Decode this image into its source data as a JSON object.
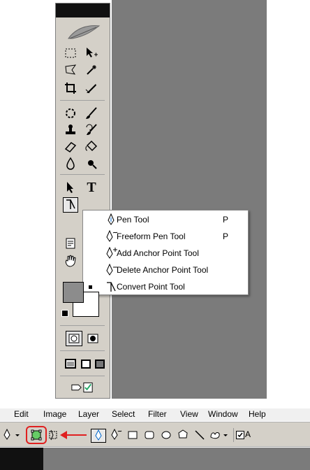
{
  "toolbox": {
    "tools": [
      {
        "name": "marquee-tool",
        "icon": "rect-marquee-icon"
      },
      {
        "name": "move-tool",
        "icon": "move-icon"
      },
      {
        "name": "lasso-tool",
        "icon": "lasso-icon"
      },
      {
        "name": "magic-wand-tool",
        "icon": "magic-wand-icon"
      },
      {
        "name": "crop-tool",
        "icon": "crop-icon"
      },
      {
        "name": "slice-tool",
        "icon": "slice-icon"
      },
      {
        "name": "healing-brush-tool",
        "icon": "healing-icon"
      },
      {
        "name": "brush-tool",
        "icon": "brush-icon"
      },
      {
        "name": "clone-stamp-tool",
        "icon": "stamp-icon"
      },
      {
        "name": "history-brush-tool",
        "icon": "history-brush-icon"
      },
      {
        "name": "eraser-tool",
        "icon": "eraser-icon"
      },
      {
        "name": "paint-bucket-tool",
        "icon": "bucket-icon"
      },
      {
        "name": "blur-tool",
        "icon": "drop-icon"
      },
      {
        "name": "dodge-tool",
        "icon": "dodge-icon"
      },
      {
        "name": "path-selection-tool",
        "icon": "arrow-icon"
      },
      {
        "name": "type-tool",
        "icon": "type-icon"
      },
      {
        "name": "convert-point-tool",
        "icon": "convert-point-icon"
      },
      {
        "name": "notes-tool",
        "icon": "notes-icon"
      },
      {
        "name": "hand-tool",
        "icon": "hand-icon"
      }
    ],
    "type_label": "T",
    "colors": {
      "foreground": "#8c8c8c",
      "background": "#ffffff"
    }
  },
  "flyout": {
    "items": [
      {
        "label": "Pen Tool",
        "shortcut": "P",
        "icon": "pen-icon",
        "selected": false
      },
      {
        "label": "Freeform Pen Tool",
        "shortcut": "P",
        "icon": "freeform-pen-icon",
        "selected": false
      },
      {
        "label": "Add Anchor Point Tool",
        "shortcut": "",
        "icon": "add-anchor-icon",
        "selected": false
      },
      {
        "label": "Delete Anchor Point Tool",
        "shortcut": "",
        "icon": "delete-anchor-icon",
        "selected": false
      },
      {
        "label": "Convert Point Tool",
        "shortcut": "",
        "icon": "convert-point-icon",
        "selected": true
      }
    ]
  },
  "menubar": {
    "items": [
      "Edit",
      "Image",
      "Layer",
      "Select",
      "Filter",
      "View",
      "Window",
      "Help"
    ]
  },
  "optionsbar": {
    "checkbox_label": "A",
    "highlight_color": "#e02020"
  }
}
